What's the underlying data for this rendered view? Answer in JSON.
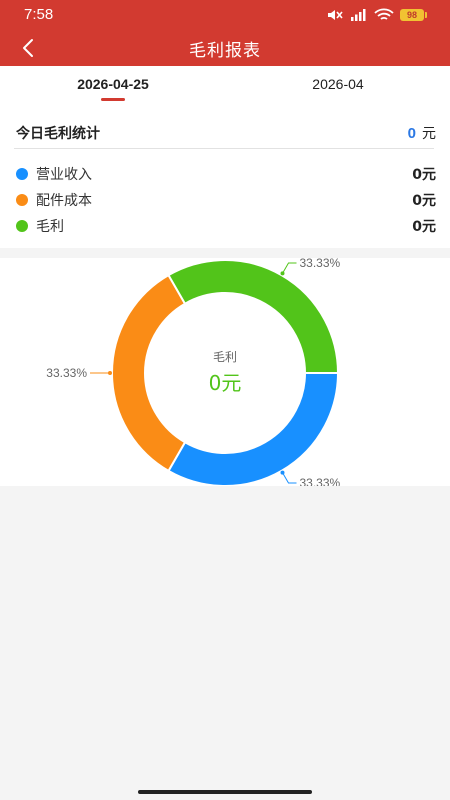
{
  "status_bar": {
    "time": "7:58",
    "battery": "98"
  },
  "nav": {
    "title": "毛利报表"
  },
  "tabs": [
    {
      "label": "2026-04-25",
      "active": true
    },
    {
      "label": "2026-04",
      "active": false
    }
  ],
  "summary": {
    "title": "今日毛利统计",
    "total_value": "0",
    "total_unit": "元",
    "items": [
      {
        "label": "营业收入",
        "value": "0元",
        "color": "#1890ff"
      },
      {
        "label": "配件成本",
        "value": "0元",
        "color": "#fa8c16"
      },
      {
        "label": "毛利",
        "value": "0元",
        "color": "#52c41a"
      }
    ]
  },
  "chart_data": {
    "type": "pie",
    "center_label": "毛利",
    "center_value": "0元",
    "center_value_color": "#52c41a",
    "slices": [
      {
        "name": "营业收入",
        "value": 33.33,
        "label": "33.33%",
        "color": "#1890ff"
      },
      {
        "name": "配件成本",
        "value": 33.33,
        "label": "33.33%",
        "color": "#fa8c16"
      },
      {
        "name": "毛利",
        "value": 33.33,
        "label": "33.33%",
        "color": "#52c41a"
      }
    ]
  }
}
